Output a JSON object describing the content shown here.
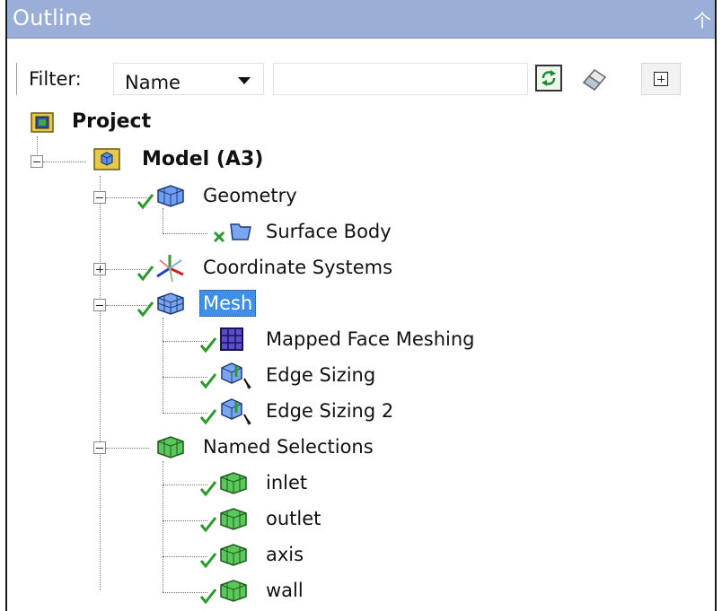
{
  "panel": {
    "title": "Outline",
    "pin_icon": "pin-icon"
  },
  "filter": {
    "label": "Filter:",
    "selected": "Name",
    "options_visible": [
      "Name"
    ],
    "search_value": "",
    "buttons": [
      "refresh-icon",
      "eraser-icon",
      "expand-all-icon"
    ]
  },
  "tree": {
    "project": {
      "label": "Project"
    },
    "model": {
      "label": "Model (A3)"
    },
    "geometry": {
      "label": "Geometry"
    },
    "surface_body": {
      "label": "Surface Body"
    },
    "coordinate_systems": {
      "label": "Coordinate Systems"
    },
    "mesh": {
      "label": "Mesh"
    },
    "mapped_face_meshing": {
      "label": "Mapped Face Meshing"
    },
    "edge_sizing": {
      "label": "Edge Sizing"
    },
    "edge_sizing_2": {
      "label": "Edge Sizing 2"
    },
    "named_selections": {
      "label": "Named Selections"
    },
    "inlet": {
      "label": "inlet"
    },
    "outlet": {
      "label": "outlet"
    },
    "axis": {
      "label": "axis"
    },
    "wall": {
      "label": "wall"
    }
  },
  "colors": {
    "title_bar": "#9aaed8",
    "selection": "#3f8fe6",
    "check": "#2a9a2a"
  }
}
